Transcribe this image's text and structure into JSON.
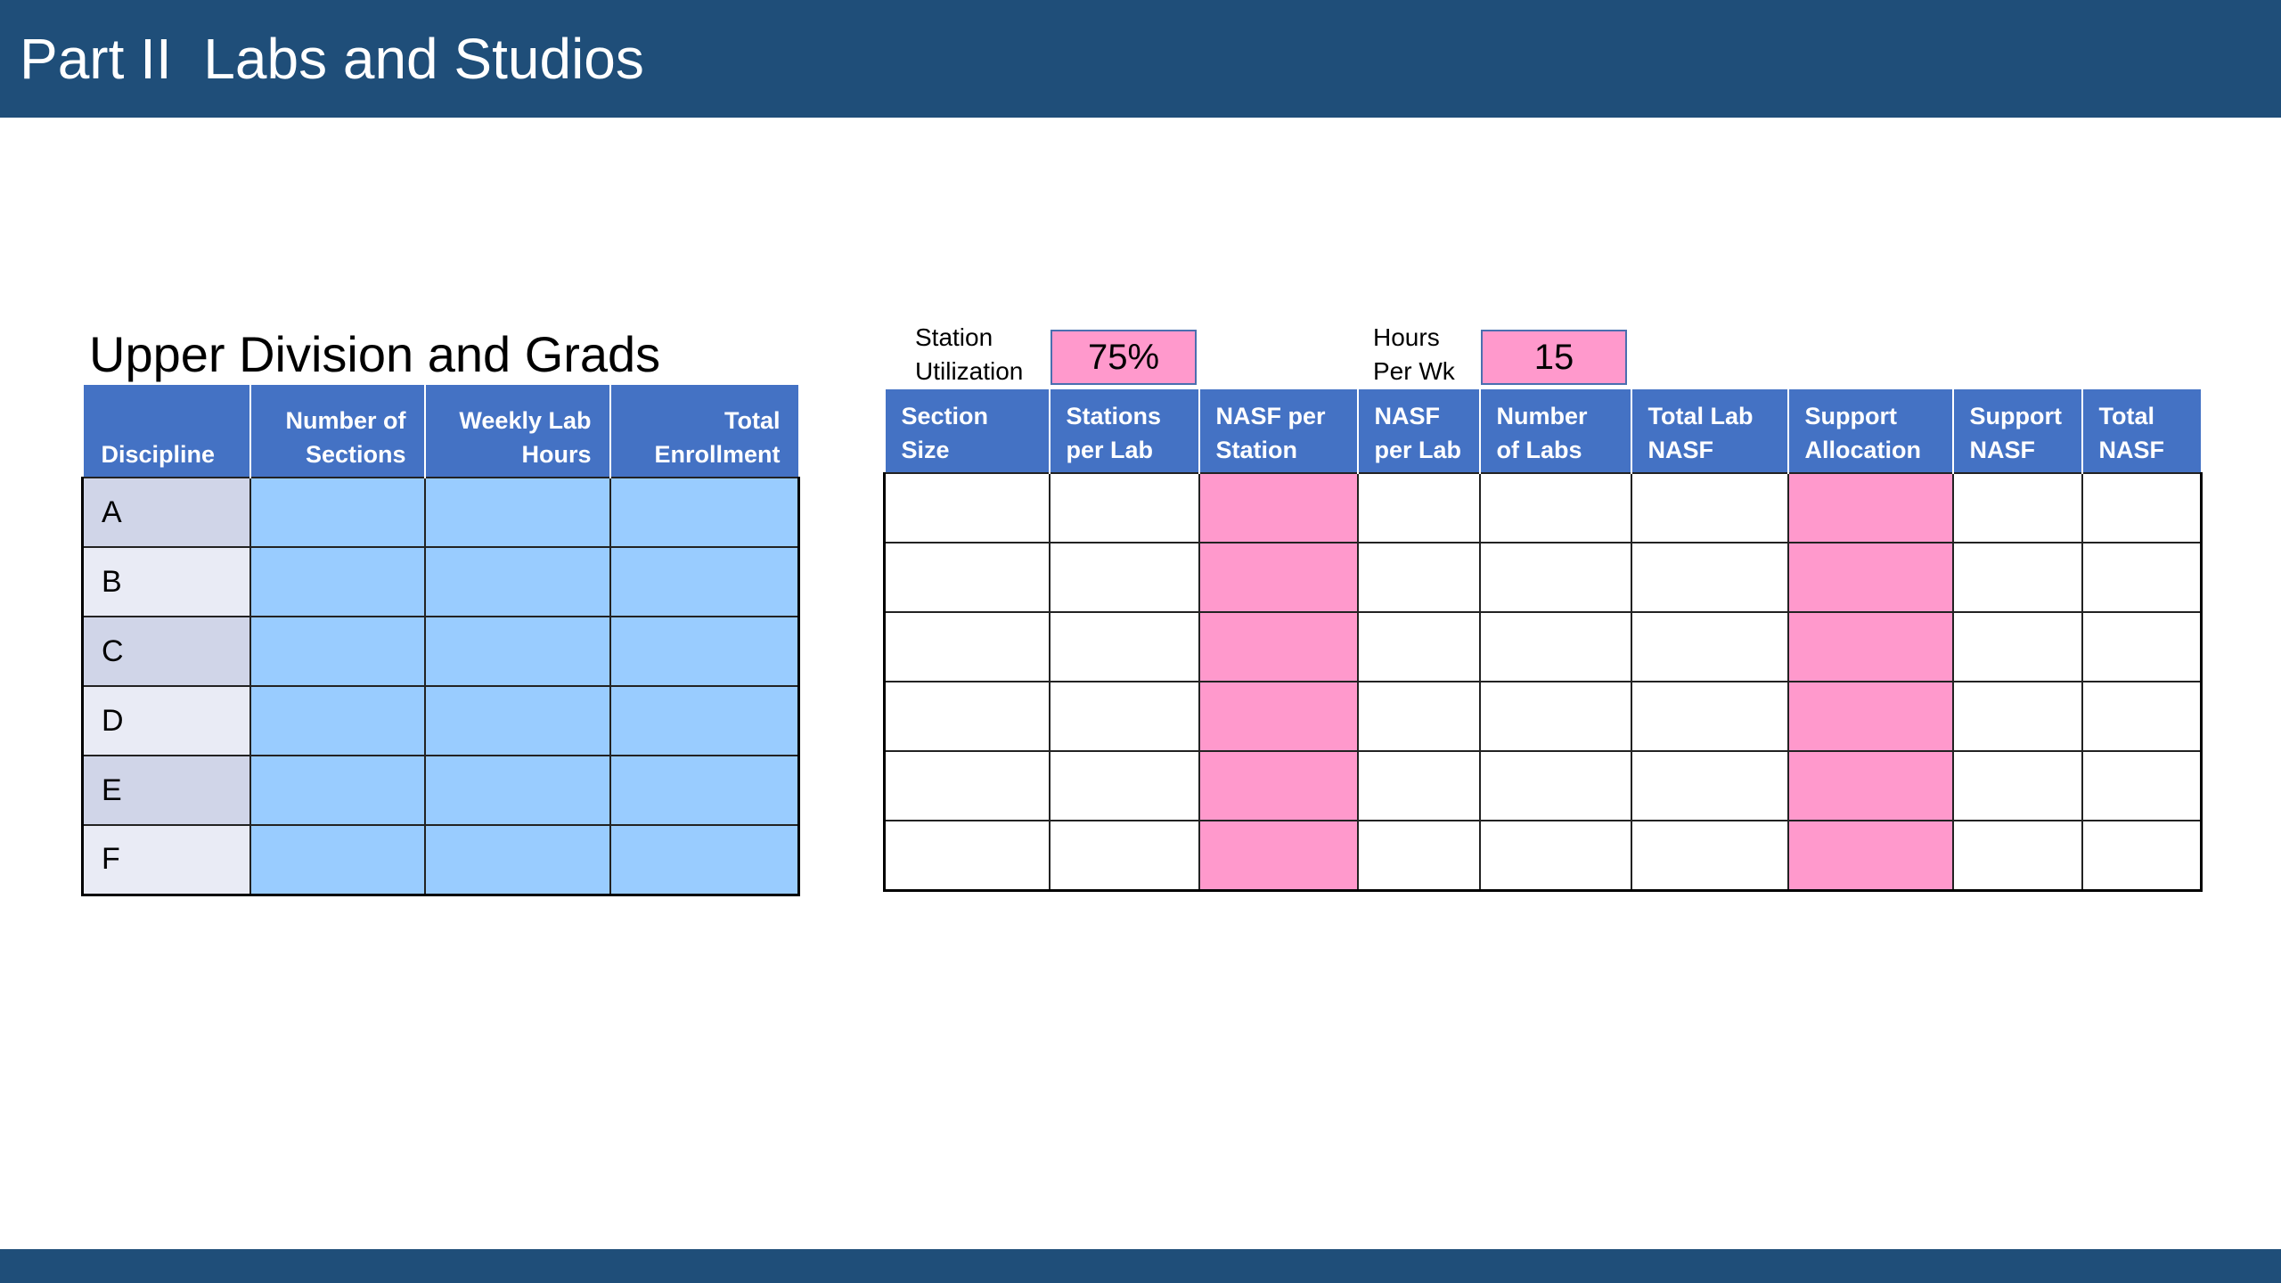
{
  "header": {
    "title": "Part II  Labs and Studios"
  },
  "section": {
    "title": "Upper Division and Grads"
  },
  "params": {
    "station_utilization": {
      "label_line1": "Station",
      "label_line2": "Utilization",
      "value": "75%"
    },
    "hours_per_week": {
      "label_line1": "Hours",
      "label_line2": "Per Wk",
      "value": "15"
    }
  },
  "left_table": {
    "headers": [
      "Discipline",
      "Number of Sections",
      "Weekly Lab Hours",
      "Total Enrollment"
    ],
    "rows": [
      "A",
      "B",
      "C",
      "D",
      "E",
      "F"
    ]
  },
  "right_table": {
    "headers": [
      "Section Size",
      "Stations per Lab",
      "NASF per Station",
      "NASF per Lab",
      "Number of Labs",
      "Total Lab NASF",
      "Support Allocation",
      "Support NASF",
      "Total NASF"
    ]
  },
  "colors": {
    "title_bar": "#1f4e79",
    "header_fill": "#4472c4",
    "input_blue": "#99ccff",
    "input_pink": "#ff99cc"
  }
}
